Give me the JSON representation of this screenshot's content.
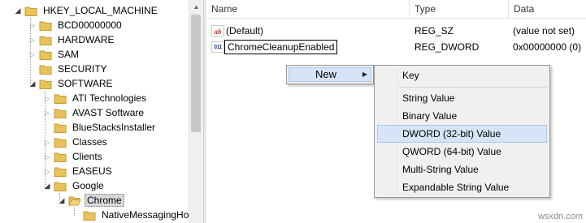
{
  "tree": {
    "items": [
      {
        "label": "HKEY_LOCAL_MACHINE",
        "state": "expanded"
      },
      {
        "label": "BCD00000000",
        "state": "collapsed"
      },
      {
        "label": "HARDWARE",
        "state": "collapsed"
      },
      {
        "label": "SAM",
        "state": "collapsed"
      },
      {
        "label": "SECURITY",
        "state": "none"
      },
      {
        "label": "SOFTWARE",
        "state": "expanded"
      },
      {
        "label": "ATI Technologies",
        "state": "collapsed"
      },
      {
        "label": "AVAST Software",
        "state": "collapsed"
      },
      {
        "label": "BlueStacksInstaller",
        "state": "none"
      },
      {
        "label": "Classes",
        "state": "collapsed"
      },
      {
        "label": "Clients",
        "state": "collapsed"
      },
      {
        "label": "EASEUS",
        "state": "collapsed"
      },
      {
        "label": "Google",
        "state": "expanded"
      },
      {
        "label": "Chrome",
        "state": "expanded",
        "selected": true
      },
      {
        "label": "NativeMessagingHo",
        "state": "none"
      }
    ]
  },
  "list": {
    "headers": {
      "name": "Name",
      "type": "Type",
      "data": "Data"
    },
    "rows": [
      {
        "icon": "string-value-icon",
        "icon_text": "ab",
        "name": "(Default)",
        "type": "REG_SZ",
        "data": "(value not set)"
      },
      {
        "icon": "binary-value-icon",
        "icon_text": "011\n110",
        "name": "ChromeCleanupEnabled",
        "type": "REG_DWORD",
        "data": "0x00000000 (0)",
        "editing": true
      }
    ]
  },
  "context_menu": {
    "item_label": "New",
    "submenu_arrow": "▶"
  },
  "submenu": {
    "items": [
      {
        "label": "Key"
      },
      {
        "label": "String Value"
      },
      {
        "label": "Binary Value"
      },
      {
        "label": "DWORD (32-bit) Value",
        "highlighted": true
      },
      {
        "label": "QWORD (64-bit) Value"
      },
      {
        "label": "Multi-String Value"
      },
      {
        "label": "Expandable String Value"
      }
    ]
  },
  "watermark": "wsxdn.com",
  "colors": {
    "folder": "#e8c25c",
    "folder_dark": "#c99a2e",
    "highlight_bg": "#d5e4f6",
    "highlight_border": "#a8c8ee"
  }
}
